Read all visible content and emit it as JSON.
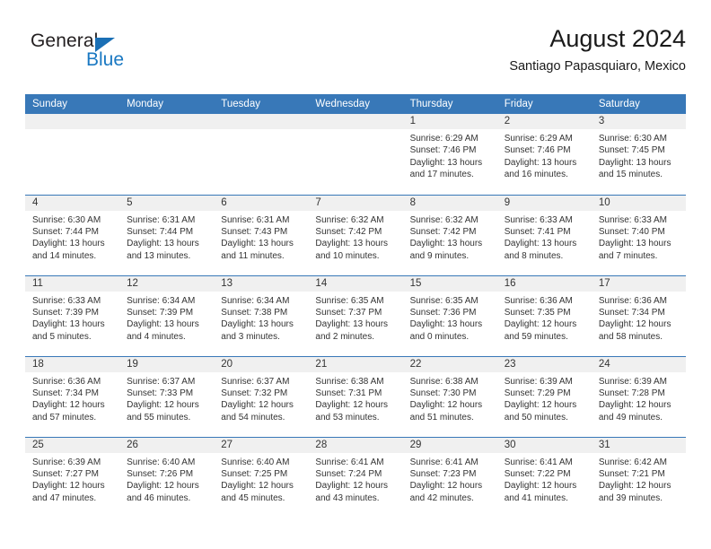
{
  "brand": {
    "name_dark": "General",
    "name_blue": "Blue",
    "accent_color": "#1a78c2",
    "triangle_color": "#1a6fb5"
  },
  "header": {
    "title": "August 2024",
    "subtitle": "Santiago Papasquiaro, Mexico"
  },
  "table": {
    "header_bg": "#3878b8",
    "daynum_bg": "#f0f0f0",
    "columns": [
      "Sunday",
      "Monday",
      "Tuesday",
      "Wednesday",
      "Thursday",
      "Friday",
      "Saturday"
    ]
  },
  "weeks": [
    [
      {
        "day": "",
        "lines": []
      },
      {
        "day": "",
        "lines": []
      },
      {
        "day": "",
        "lines": []
      },
      {
        "day": "",
        "lines": []
      },
      {
        "day": "1",
        "lines": [
          "Sunrise: 6:29 AM",
          "Sunset: 7:46 PM",
          "Daylight: 13 hours",
          "and 17 minutes."
        ]
      },
      {
        "day": "2",
        "lines": [
          "Sunrise: 6:29 AM",
          "Sunset: 7:46 PM",
          "Daylight: 13 hours",
          "and 16 minutes."
        ]
      },
      {
        "day": "3",
        "lines": [
          "Sunrise: 6:30 AM",
          "Sunset: 7:45 PM",
          "Daylight: 13 hours",
          "and 15 minutes."
        ]
      }
    ],
    [
      {
        "day": "4",
        "lines": [
          "Sunrise: 6:30 AM",
          "Sunset: 7:44 PM",
          "Daylight: 13 hours",
          "and 14 minutes."
        ]
      },
      {
        "day": "5",
        "lines": [
          "Sunrise: 6:31 AM",
          "Sunset: 7:44 PM",
          "Daylight: 13 hours",
          "and 13 minutes."
        ]
      },
      {
        "day": "6",
        "lines": [
          "Sunrise: 6:31 AM",
          "Sunset: 7:43 PM",
          "Daylight: 13 hours",
          "and 11 minutes."
        ]
      },
      {
        "day": "7",
        "lines": [
          "Sunrise: 6:32 AM",
          "Sunset: 7:42 PM",
          "Daylight: 13 hours",
          "and 10 minutes."
        ]
      },
      {
        "day": "8",
        "lines": [
          "Sunrise: 6:32 AM",
          "Sunset: 7:42 PM",
          "Daylight: 13 hours",
          "and 9 minutes."
        ]
      },
      {
        "day": "9",
        "lines": [
          "Sunrise: 6:33 AM",
          "Sunset: 7:41 PM",
          "Daylight: 13 hours",
          "and 8 minutes."
        ]
      },
      {
        "day": "10",
        "lines": [
          "Sunrise: 6:33 AM",
          "Sunset: 7:40 PM",
          "Daylight: 13 hours",
          "and 7 minutes."
        ]
      }
    ],
    [
      {
        "day": "11",
        "lines": [
          "Sunrise: 6:33 AM",
          "Sunset: 7:39 PM",
          "Daylight: 13 hours",
          "and 5 minutes."
        ]
      },
      {
        "day": "12",
        "lines": [
          "Sunrise: 6:34 AM",
          "Sunset: 7:39 PM",
          "Daylight: 13 hours",
          "and 4 minutes."
        ]
      },
      {
        "day": "13",
        "lines": [
          "Sunrise: 6:34 AM",
          "Sunset: 7:38 PM",
          "Daylight: 13 hours",
          "and 3 minutes."
        ]
      },
      {
        "day": "14",
        "lines": [
          "Sunrise: 6:35 AM",
          "Sunset: 7:37 PM",
          "Daylight: 13 hours",
          "and 2 minutes."
        ]
      },
      {
        "day": "15",
        "lines": [
          "Sunrise: 6:35 AM",
          "Sunset: 7:36 PM",
          "Daylight: 13 hours",
          "and 0 minutes."
        ]
      },
      {
        "day": "16",
        "lines": [
          "Sunrise: 6:36 AM",
          "Sunset: 7:35 PM",
          "Daylight: 12 hours",
          "and 59 minutes."
        ]
      },
      {
        "day": "17",
        "lines": [
          "Sunrise: 6:36 AM",
          "Sunset: 7:34 PM",
          "Daylight: 12 hours",
          "and 58 minutes."
        ]
      }
    ],
    [
      {
        "day": "18",
        "lines": [
          "Sunrise: 6:36 AM",
          "Sunset: 7:34 PM",
          "Daylight: 12 hours",
          "and 57 minutes."
        ]
      },
      {
        "day": "19",
        "lines": [
          "Sunrise: 6:37 AM",
          "Sunset: 7:33 PM",
          "Daylight: 12 hours",
          "and 55 minutes."
        ]
      },
      {
        "day": "20",
        "lines": [
          "Sunrise: 6:37 AM",
          "Sunset: 7:32 PM",
          "Daylight: 12 hours",
          "and 54 minutes."
        ]
      },
      {
        "day": "21",
        "lines": [
          "Sunrise: 6:38 AM",
          "Sunset: 7:31 PM",
          "Daylight: 12 hours",
          "and 53 minutes."
        ]
      },
      {
        "day": "22",
        "lines": [
          "Sunrise: 6:38 AM",
          "Sunset: 7:30 PM",
          "Daylight: 12 hours",
          "and 51 minutes."
        ]
      },
      {
        "day": "23",
        "lines": [
          "Sunrise: 6:39 AM",
          "Sunset: 7:29 PM",
          "Daylight: 12 hours",
          "and 50 minutes."
        ]
      },
      {
        "day": "24",
        "lines": [
          "Sunrise: 6:39 AM",
          "Sunset: 7:28 PM",
          "Daylight: 12 hours",
          "and 49 minutes."
        ]
      }
    ],
    [
      {
        "day": "25",
        "lines": [
          "Sunrise: 6:39 AM",
          "Sunset: 7:27 PM",
          "Daylight: 12 hours",
          "and 47 minutes."
        ]
      },
      {
        "day": "26",
        "lines": [
          "Sunrise: 6:40 AM",
          "Sunset: 7:26 PM",
          "Daylight: 12 hours",
          "and 46 minutes."
        ]
      },
      {
        "day": "27",
        "lines": [
          "Sunrise: 6:40 AM",
          "Sunset: 7:25 PM",
          "Daylight: 12 hours",
          "and 45 minutes."
        ]
      },
      {
        "day": "28",
        "lines": [
          "Sunrise: 6:41 AM",
          "Sunset: 7:24 PM",
          "Daylight: 12 hours",
          "and 43 minutes."
        ]
      },
      {
        "day": "29",
        "lines": [
          "Sunrise: 6:41 AM",
          "Sunset: 7:23 PM",
          "Daylight: 12 hours",
          "and 42 minutes."
        ]
      },
      {
        "day": "30",
        "lines": [
          "Sunrise: 6:41 AM",
          "Sunset: 7:22 PM",
          "Daylight: 12 hours",
          "and 41 minutes."
        ]
      },
      {
        "day": "31",
        "lines": [
          "Sunrise: 6:42 AM",
          "Sunset: 7:21 PM",
          "Daylight: 12 hours",
          "and 39 minutes."
        ]
      }
    ]
  ]
}
